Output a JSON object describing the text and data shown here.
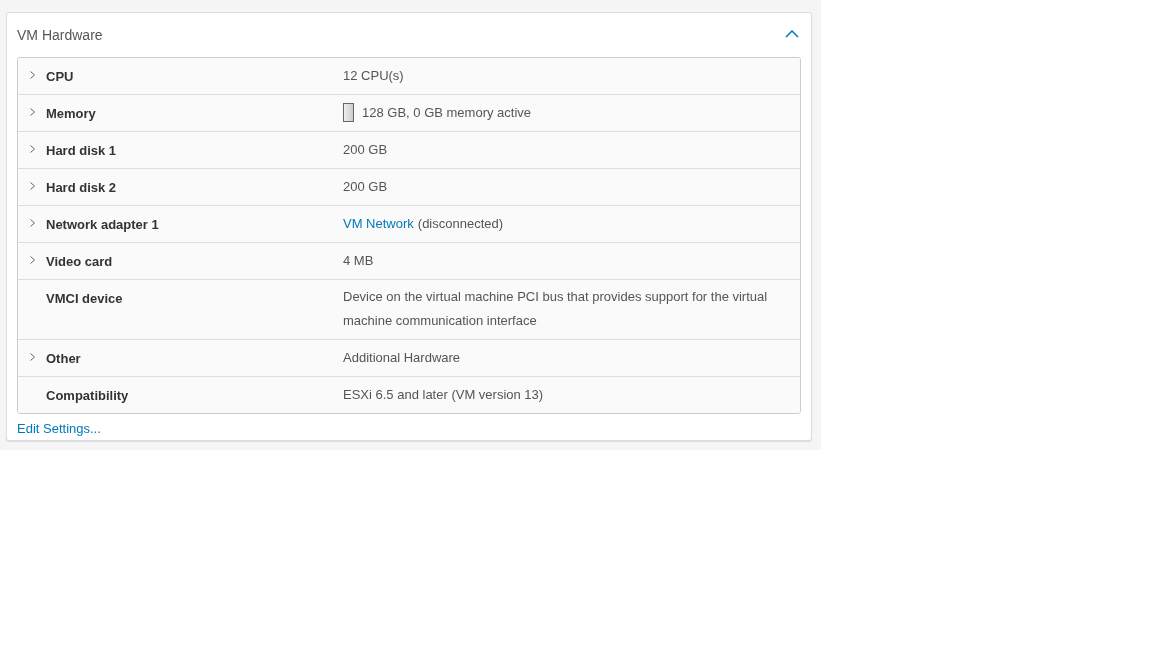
{
  "card": {
    "title": "VM Hardware",
    "expanded": true
  },
  "rows": [
    {
      "label": "CPU",
      "expandable": true,
      "kind": "text",
      "value": "12 CPU(s)"
    },
    {
      "label": "Memory",
      "expandable": true,
      "kind": "meter",
      "level": 0,
      "value": "128 GB, 0 GB memory active"
    },
    {
      "label": "Hard disk 1",
      "expandable": true,
      "kind": "text",
      "value": "200 GB"
    },
    {
      "label": "Hard disk 2",
      "expandable": true,
      "kind": "text",
      "value": "200 GB"
    },
    {
      "label": "Network adapter 1",
      "expandable": true,
      "kind": "link",
      "link": "VM Network",
      "value": "(disconnected)"
    },
    {
      "label": "Video card",
      "expandable": true,
      "kind": "text",
      "value": "4 MB"
    },
    {
      "label": "VMCI device",
      "expandable": false,
      "kind": "text",
      "value": "Device on the virtual machine PCI bus that provides support for the virtual machine communication interface"
    },
    {
      "label": "Other",
      "expandable": true,
      "kind": "text",
      "value": "Additional Hardware"
    },
    {
      "label": "Compatibility",
      "expandable": false,
      "kind": "text",
      "value": "ESXi 6.5 and later (VM version 13)"
    }
  ],
  "footer_link": "Edit Settings..."
}
